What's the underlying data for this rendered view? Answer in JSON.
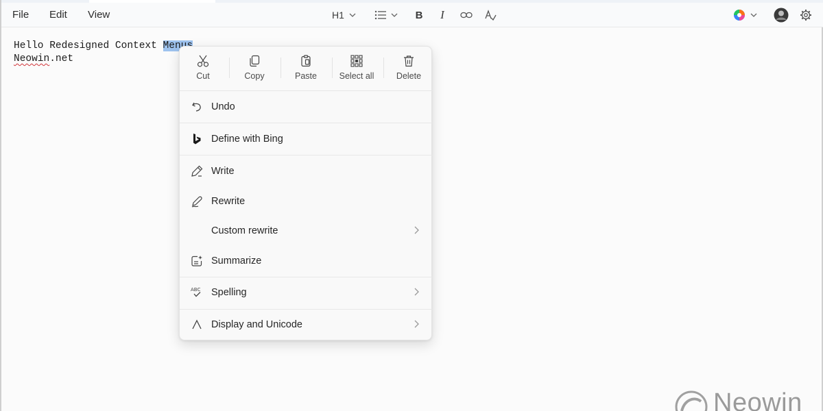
{
  "menubar": {
    "file": "File",
    "edit": "Edit",
    "view": "View"
  },
  "toolbar": {
    "heading": "H1",
    "icons": [
      "chevron-down-icon",
      "list-icon",
      "bold-icon",
      "italic-icon",
      "link-icon",
      "clear-format-icon",
      "copilot-icon",
      "avatar",
      "gear-icon"
    ],
    "bold": "B",
    "italic": "I"
  },
  "editor": {
    "line1_before": "Hello Redesigned Context ",
    "line1_selected": "Menus",
    "line2_misspelled": "Neowin",
    "line2_rest": ".net"
  },
  "context_menu": {
    "commands": [
      {
        "label": "Cut",
        "icon": "scissors-icon"
      },
      {
        "label": "Copy",
        "icon": "copy-icon"
      },
      {
        "label": "Paste",
        "icon": "paste-icon"
      },
      {
        "label": "Select all",
        "icon": "select-all-icon"
      },
      {
        "label": "Delete",
        "icon": "trash-icon"
      }
    ],
    "items": [
      {
        "label": "Undo",
        "icon": "undo-icon"
      },
      {
        "label": "Define with Bing",
        "icon": "bing-icon"
      },
      {
        "label": "Write",
        "icon": "write-icon"
      },
      {
        "label": "Rewrite",
        "icon": "rewrite-icon"
      },
      {
        "label": "Custom rewrite",
        "icon": "",
        "submenu": true
      },
      {
        "label": "Summarize",
        "icon": "summarize-icon"
      },
      {
        "label": "Spelling",
        "icon": "spelling-icon",
        "submenu": true
      },
      {
        "label": "Display and Unicode",
        "icon": "caret-icon",
        "submenu": true
      }
    ]
  },
  "watermark": {
    "text": "Neowin"
  },
  "colors": {
    "selection": "#9ec3ef",
    "spelling_underline": "#d13438"
  }
}
